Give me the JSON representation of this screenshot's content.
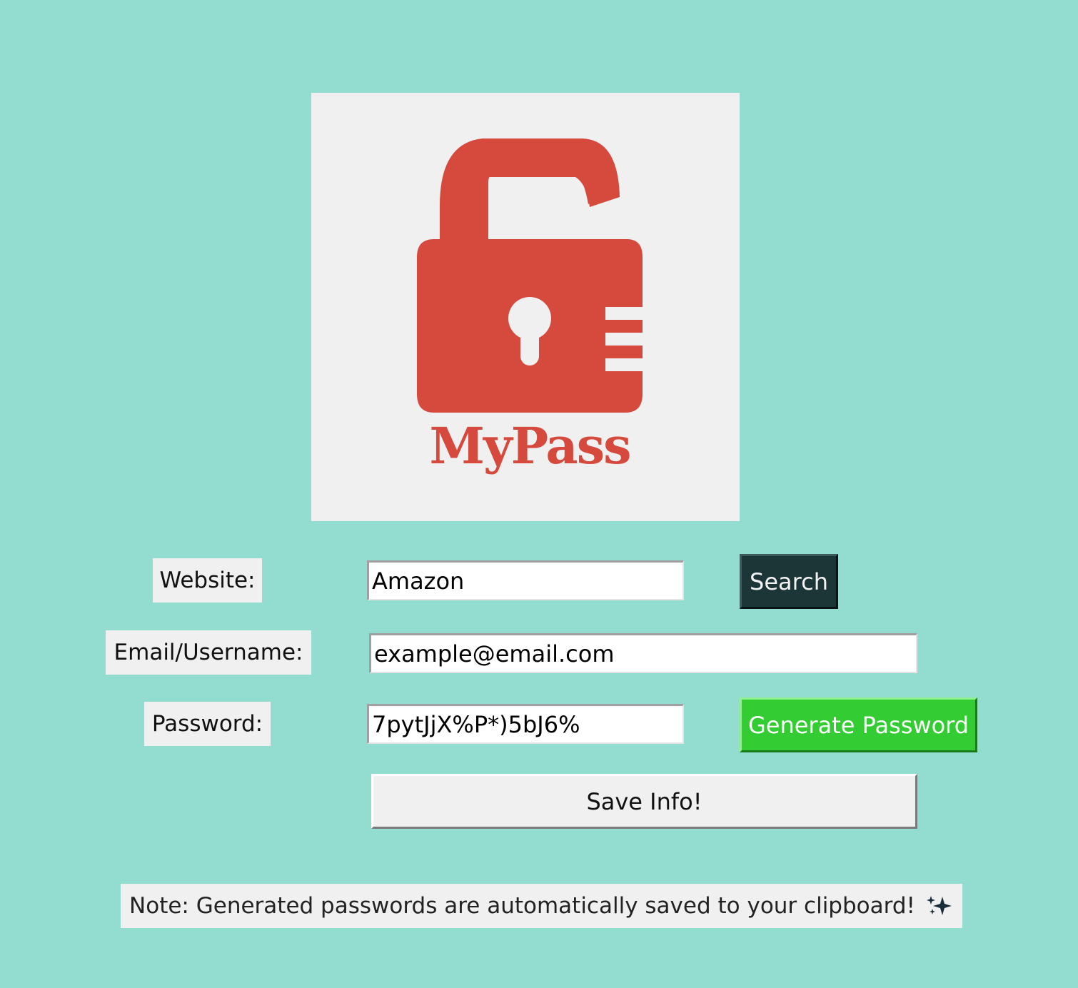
{
  "logo": {
    "text": "MyPass",
    "color": "#d64a3e"
  },
  "form": {
    "website_label": "Website:",
    "website_value": "Amazon",
    "email_label": "Email/Username:",
    "email_value": "example@email.com",
    "password_label": "Password:",
    "password_value": "7pytJjX%P*)5bJ6%"
  },
  "buttons": {
    "search": "Search",
    "generate": "Generate Password",
    "save": "Save Info!"
  },
  "note": {
    "text": "Note: Generated passwords are automatically saved to your clipboard!",
    "icon": "sparkles-icon"
  },
  "colors": {
    "background": "#92ddd0",
    "search_button": "#1c3638",
    "generate_button": "#33cc33"
  }
}
